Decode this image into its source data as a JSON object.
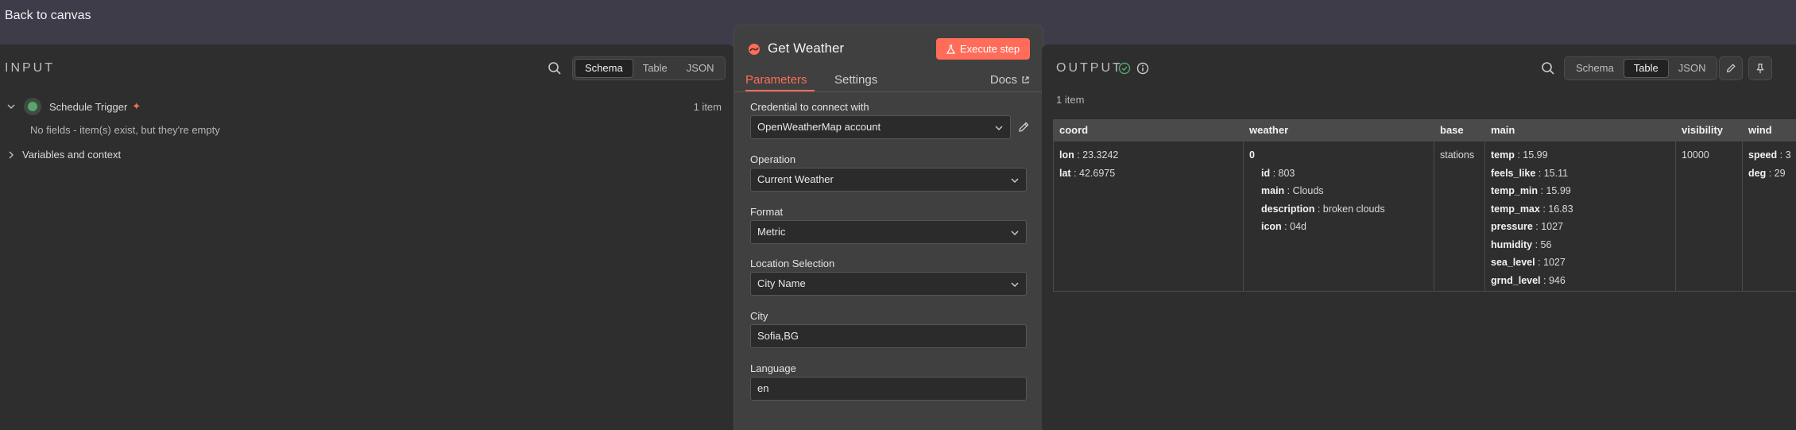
{
  "topbar": {
    "back_label": "Back to canvas"
  },
  "input": {
    "title": "INPUT",
    "view_tabs": [
      "Schema",
      "Table",
      "JSON"
    ],
    "active_tab": "Schema",
    "trigger": {
      "name": "Schedule Trigger",
      "count": "1 item",
      "message": "No fields - item(s) exist, but they're empty"
    },
    "variables_label": "Variables and context"
  },
  "node": {
    "title": "Get Weather",
    "execute_label": "Execute step",
    "tabs": {
      "parameters": "Parameters",
      "settings": "Settings",
      "docs": "Docs"
    },
    "fields": {
      "credential": {
        "label": "Credential to connect with",
        "value": "OpenWeatherMap account"
      },
      "operation": {
        "label": "Operation",
        "value": "Current Weather"
      },
      "format": {
        "label": "Format",
        "value": "Metric"
      },
      "location": {
        "label": "Location Selection",
        "value": "City Name"
      },
      "city": {
        "label": "City",
        "value": "Sofia,BG"
      },
      "language": {
        "label": "Language",
        "value": "en"
      }
    }
  },
  "output": {
    "title": "OUTPUT",
    "view_tabs": [
      "Schema",
      "Table",
      "JSON"
    ],
    "active_tab": "Table",
    "count": "1 item",
    "columns": {
      "coord": {
        "header": "coord",
        "lon_k": "lon",
        "lon_v": "23.3242",
        "lat_k": "lat",
        "lat_v": "42.6975"
      },
      "weather": {
        "header": "weather",
        "index": "0",
        "id_k": "id",
        "id_v": "803",
        "main_k": "main",
        "main_v": "Clouds",
        "desc_k": "description",
        "desc_v": "broken clouds",
        "icon_k": "icon",
        "icon_v": "04d"
      },
      "base": {
        "header": "base",
        "value": "stations"
      },
      "main": {
        "header": "main",
        "temp_k": "temp",
        "temp_v": "15.99",
        "feels_k": "feels_like",
        "feels_v": "15.11",
        "tmin_k": "temp_min",
        "tmin_v": "15.99",
        "tmax_k": "temp_max",
        "tmax_v": "16.83",
        "pressure_k": "pressure",
        "pressure_v": "1027",
        "humidity_k": "humidity",
        "humidity_v": "56",
        "sea_k": "sea_level",
        "sea_v": "1027",
        "grnd_k": "grnd_level",
        "grnd_v": "946"
      },
      "visibility": {
        "header": "visibility",
        "value": "10000"
      },
      "wind": {
        "header": "wind",
        "speed_k": "speed",
        "speed_v": ": 3",
        "deg_k": "deg",
        "deg_v": ": 29"
      }
    }
  },
  "colors": {
    "accent": "#ff6d5a",
    "success": "#5aa46d",
    "panel": "#2e2e2e"
  }
}
